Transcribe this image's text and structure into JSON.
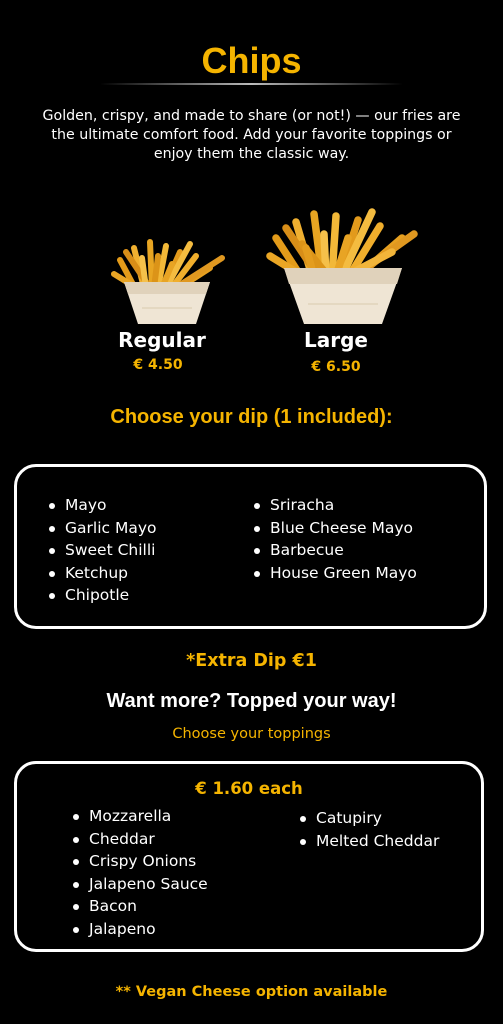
{
  "title": "Chips",
  "intro": "Golden, crispy, and made to share (or not!) — our fries are the ultimate comfort food. Add your favorite toppings or enjoy them the classic way.",
  "sizes": [
    {
      "name": "Regular",
      "price": "€ 4.50",
      "image": "fries-in-paper-cone-small"
    },
    {
      "name": "Large",
      "price": "€ 6.50",
      "image": "fries-in-paper-cone-large"
    }
  ],
  "dips": {
    "heading": "Choose your dip (1 included):",
    "left": [
      "Mayo",
      "Garlic Mayo",
      "Sweet Chilli",
      "Ketchup",
      "Chipotle"
    ],
    "right": [
      "Sriracha",
      "Blue Cheese Mayo",
      "Barbecue",
      "House Green Mayo"
    ],
    "extra": "*Extra Dip €1"
  },
  "toppings": {
    "heading": "Want more? Topped your way!",
    "subheading": "Choose your toppings",
    "price": "€ 1.60 each",
    "left": [
      "Mozzarella",
      "Cheddar",
      "Crispy Onions",
      "Jalapeno Sauce",
      "Bacon",
      "Jalapeno"
    ],
    "right": [
      "Catupiry",
      "Melted Cheddar"
    ]
  },
  "footnote": "** Vegan Cheese option available",
  "colors": {
    "accent": "#f5b400",
    "background": "#000000",
    "text": "#ffffff"
  }
}
